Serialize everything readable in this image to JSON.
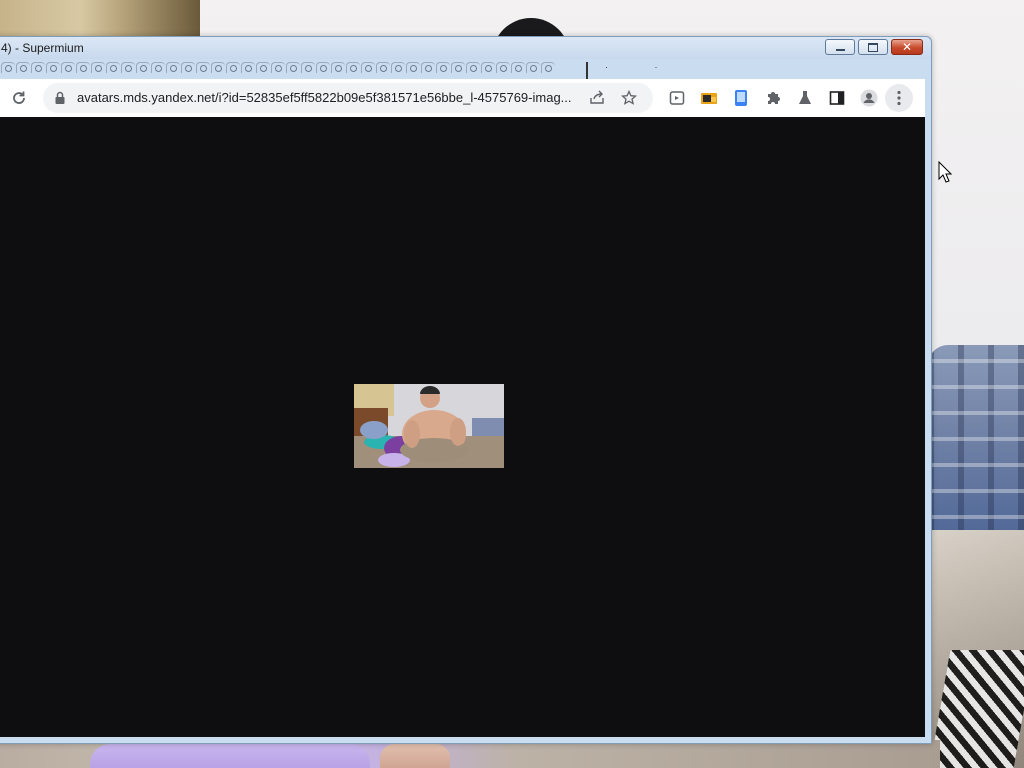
{
  "window": {
    "title": "4) - Supermium",
    "controls": {
      "minimize": "minimize-icon",
      "maximize": "maximize-icon",
      "close": "close-icon"
    }
  },
  "tabstrip": {
    "tab_count": 37,
    "overflow_marks": "· ·"
  },
  "toolbar": {
    "reload_icon": "reload-icon",
    "url": "avatars.mds.yandex.net/i?id=52835ef5ff5822b09e5f381571e56bbe_l-4575769-imag...",
    "omnibox_icons": [
      "share-icon",
      "star-icon"
    ],
    "extension_icons": [
      "tab-icon",
      "folder-extension-icon",
      "phone-extension-icon",
      "puzzle-icon",
      "flask-icon",
      "side-panel-icon",
      "profile-icon",
      "menu-dots-icon"
    ]
  },
  "content": {
    "image_description": "photo thumbnail",
    "background": "#0e0e10"
  },
  "colors": {
    "titlebar": "#c8d9ee",
    "close_button": "#c84a2c",
    "omnibox": "#f1f3f4"
  }
}
